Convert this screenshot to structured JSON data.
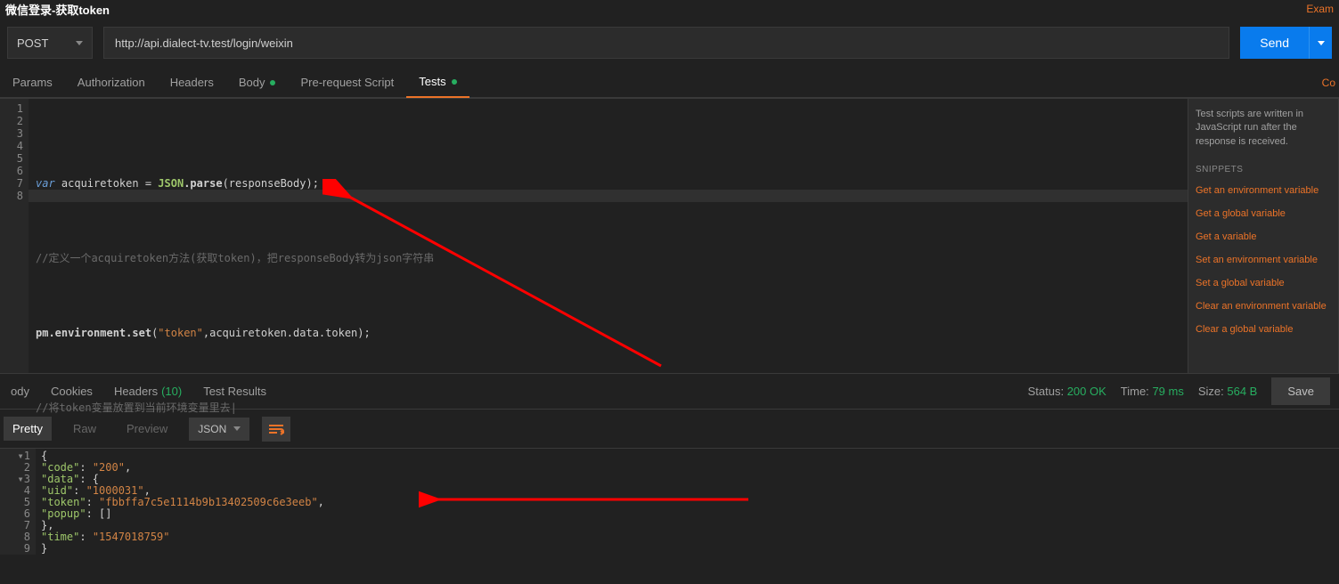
{
  "crumb": {
    "title": "微信登录-获取token"
  },
  "topright": {
    "examples": "Exam"
  },
  "request": {
    "method": "POST",
    "url": "http://api.dialect-tv.test/login/weixin",
    "send_label": "Send"
  },
  "req_tabs": {
    "params": "Params",
    "auth": "Authorization",
    "headers": "Headers",
    "body": "Body",
    "prereq": "Pre-request Script",
    "tests": "Tests",
    "co": "Co"
  },
  "code": {
    "lines": [
      "1",
      "2",
      "3",
      "4",
      "5",
      "6",
      "7",
      "8"
    ],
    "l2_kw": "var",
    "l2_name": " acquiretoken ",
    "l2_eq": "= ",
    "l2_cls": "JSON",
    "l2_fn": ".parse",
    "l2_arg": "(responseBody);",
    "l4": "//定义一个acquiretoken方法(获取token)，把responseBody转为json字符串",
    "l6_a": "pm.environment.",
    "l6_fn": "set",
    "l6_open": "(",
    "l6_str": "\"token\"",
    "l6_rest": ",acquiretoken.data.token);",
    "l8": "//将token变量放置到当前环境变量里去|"
  },
  "snippets": {
    "desc": "Test scripts are written in JavaScript run after the response is received.",
    "heading": "SNIPPETS",
    "links": [
      "Get an environment variable",
      "Get a global variable",
      "Get a variable",
      "Set an environment variable",
      "Set a global variable",
      "Clear an environment variable",
      "Clear a global variable"
    ]
  },
  "response": {
    "tabs": {
      "body": "ody",
      "cookies": "Cookies",
      "headers": "Headers",
      "hdrcount": "(10)",
      "tests": "Test Results"
    },
    "status_lbl": "Status:",
    "status_val": "200 OK",
    "time_lbl": "Time:",
    "time_val": "79 ms",
    "size_lbl": "Size:",
    "size_val": "564 B",
    "save": "Save",
    "view": {
      "pretty": "Pretty",
      "raw": "Raw",
      "preview": "Preview",
      "fmt": "JSON"
    },
    "json": {
      "lines": [
        "1",
        "2",
        "3",
        "4",
        "5",
        "6",
        "7",
        "8",
        "9"
      ],
      "l1": "{",
      "l2_k": "\"code\"",
      "l2_v": "\"200\"",
      "l3_k": "\"data\"",
      "l4_k": "\"uid\"",
      "l4_v": "\"1000031\"",
      "l5_k": "\"token\"",
      "l5_v": "\"fbbffa7c5e1114b9b13402509c6e3eeb\"",
      "l6_k": "\"popup\"",
      "l7": "},",
      "l8_k": "\"time\"",
      "l8_v": "\"1547018759\"",
      "l9": "}"
    }
  }
}
